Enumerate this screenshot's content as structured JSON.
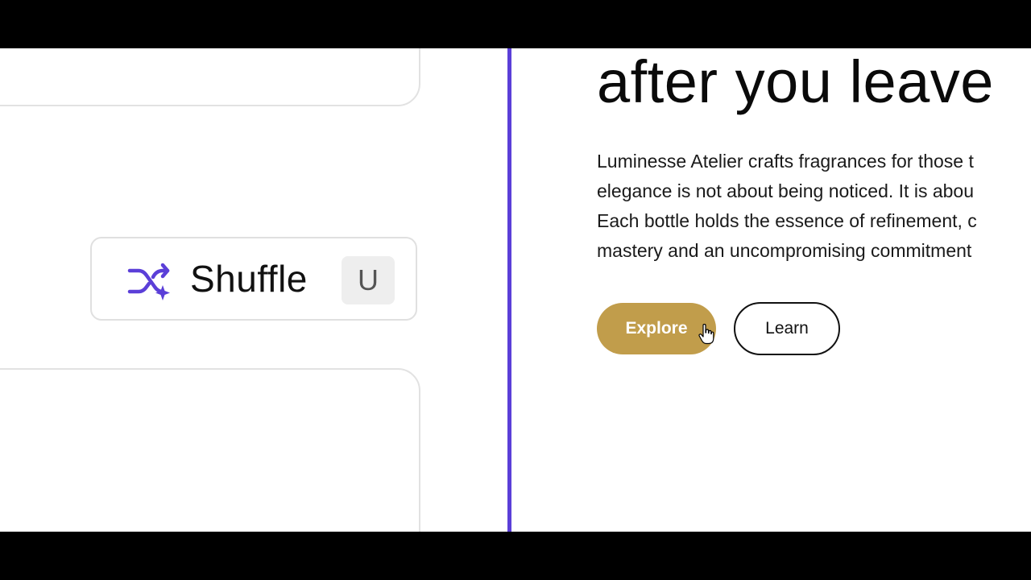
{
  "shuffle": {
    "label": "Shuffle",
    "shortcut": "U",
    "icon": "shuffle-sparkle-icon",
    "icon_color": "#5b3fd8"
  },
  "hero": {
    "heading": "after you leave",
    "body_lines": [
      "Luminesse Atelier crafts fragrances for those t",
      "elegance is not about being noticed. It is abou",
      "Each bottle holds the essence of refinement, c",
      "mastery and an uncompromising commitment"
    ],
    "primary_button": "Explore",
    "secondary_button": "Learn"
  },
  "colors": {
    "accent": "#5b3fd8",
    "gold": "#c19d4b"
  }
}
